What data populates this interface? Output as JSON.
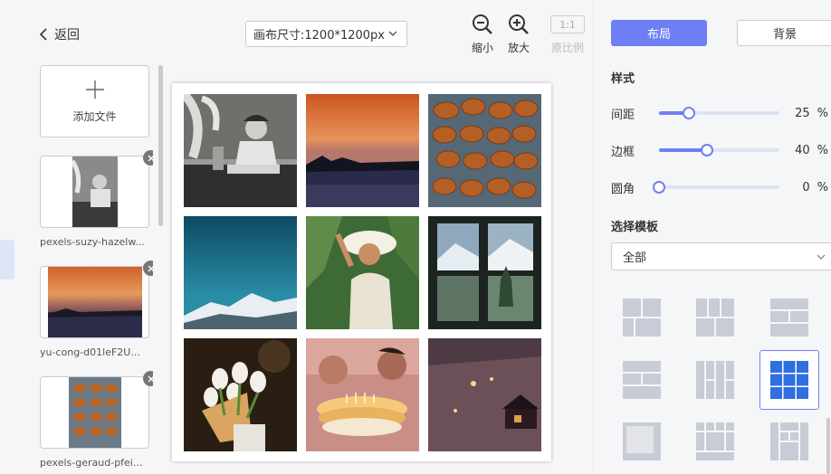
{
  "header": {
    "back_label": "返回",
    "canvas_size": "画布尺寸:1200*1200px",
    "zoom_out_label": "缩小",
    "zoom_in_label": "放大",
    "ratio_badge": "1:1",
    "ratio_label": "原比例"
  },
  "files": {
    "add_label": "添加文件",
    "items": [
      {
        "name": "pexels-suzy-hazelw..."
      },
      {
        "name": "yu-cong-d01leF2U..."
      },
      {
        "name": "pexels-geraud-pfei..."
      }
    ]
  },
  "panel": {
    "tab_layout": "布局",
    "tab_background": "背景",
    "style_title": "样式",
    "sliders": [
      {
        "label": "间距",
        "value": "25",
        "unit": "%",
        "level": 0.25
      },
      {
        "label": "边框",
        "value": "40",
        "unit": "%",
        "level": 0.4
      },
      {
        "label": "圆角",
        "value": "0",
        "unit": "%",
        "level": 0.0
      }
    ],
    "template_title": "选择模板",
    "template_filter": "全部"
  },
  "colors": {
    "accent": "#6e7ff5",
    "template_gray": "#c9ccd6",
    "template_selected": "#2f6fe0"
  }
}
